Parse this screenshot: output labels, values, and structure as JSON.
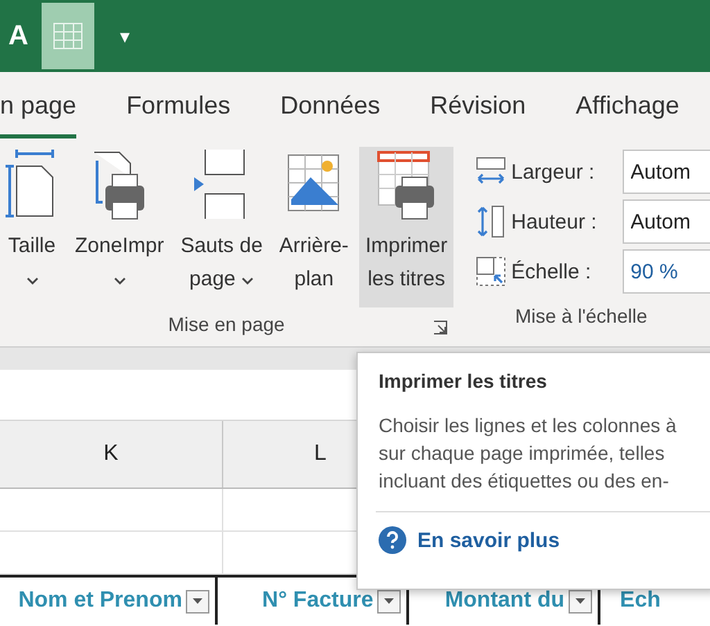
{
  "quick_access": {
    "font_letter": "A",
    "qat_arrow": "▾"
  },
  "tabs": [
    {
      "label": "n page",
      "selected": true
    },
    {
      "label": "Formules",
      "selected": false
    },
    {
      "label": "Données",
      "selected": false
    },
    {
      "label": "Révision",
      "selected": false
    },
    {
      "label": "Affichage",
      "selected": false
    }
  ],
  "page_setup_group": {
    "label": "Mise en page",
    "buttons": [
      {
        "kind": "size",
        "lines": [
          "Taille"
        ],
        "dropdown": true,
        "selected": false
      },
      {
        "kind": "print-area",
        "lines": [
          "ZoneImpr"
        ],
        "dropdown": true,
        "selected": false
      },
      {
        "kind": "breaks",
        "lines": [
          "Sauts de",
          "page"
        ],
        "dropdown": true,
        "selected": false
      },
      {
        "kind": "background",
        "lines": [
          "Arrière-",
          "plan"
        ],
        "dropdown": false,
        "selected": false
      },
      {
        "kind": "print-titles",
        "lines": [
          "Imprimer",
          "les titres"
        ],
        "dropdown": false,
        "selected": true
      }
    ]
  },
  "scale_group": {
    "label": "Mise à l'échelle",
    "rows": [
      {
        "kind": "width",
        "label": "Largeur :",
        "value": "Autom"
      },
      {
        "kind": "height",
        "label": "Hauteur :",
        "value": "Autom"
      },
      {
        "kind": "scale",
        "label": "Échelle :",
        "value": "90 %"
      }
    ]
  },
  "columns": [
    "K",
    "L"
  ],
  "header_row": [
    "Nom et Prenom",
    "N° Facture",
    "Montant du",
    "Ech"
  ],
  "tooltip": {
    "title": "Imprimer les titres",
    "lines": [
      "Choisir les lignes et les colonnes à",
      "sur chaque page imprimée, telles",
      "incluant des étiquettes ou des en-"
    ],
    "link": "En savoir plus"
  }
}
